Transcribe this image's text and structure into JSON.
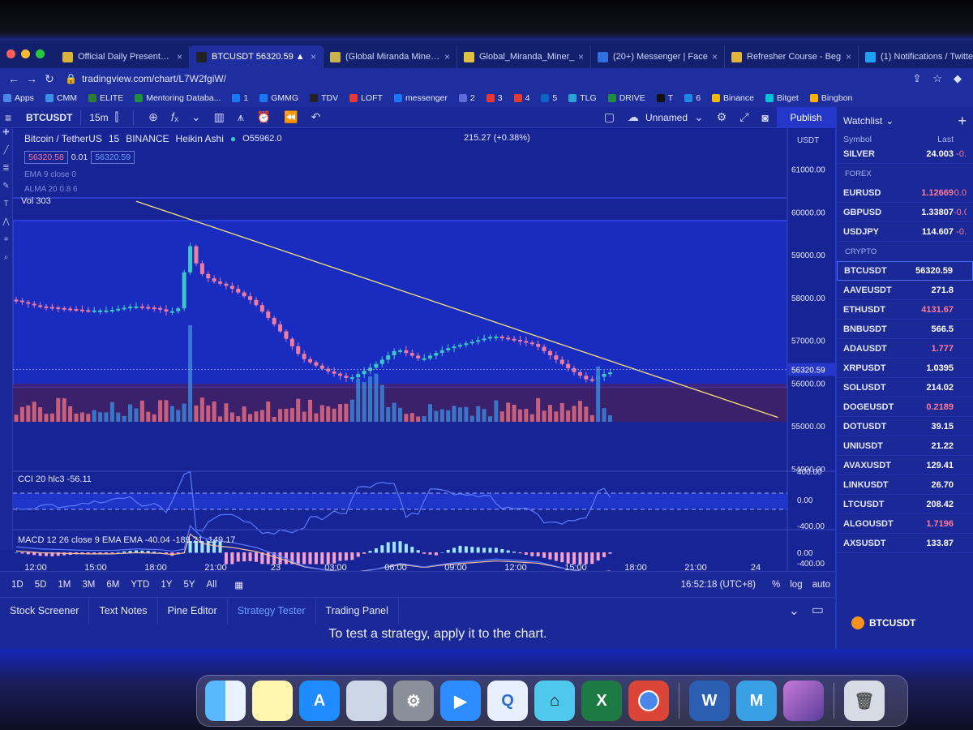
{
  "browser": {
    "tabs": [
      {
        "title": "Official Daily Presentatio",
        "favicon_color": "#d9b23a"
      },
      {
        "title": "BTCUSDT 56320.59 ▲",
        "favicon_color": "#222222",
        "active": true
      },
      {
        "title": "(Global Miranda Miner G",
        "favicon_color": "#c9b34a"
      },
      {
        "title": "Global_Miranda_Miner_",
        "favicon_color": "#e0c040"
      },
      {
        "title": "(20+) Messenger | Face",
        "favicon_color": "#2f6fe0"
      },
      {
        "title": "Refresher Course - Beg",
        "favicon_color": "#e2b43a"
      },
      {
        "title": "(1) Notifications / Twitte",
        "favicon_color": "#1da1f2"
      }
    ],
    "url": "tradingview.com/chart/L7W2fgiW/",
    "bookmarks": [
      "Apps",
      "CMM",
      "ELITE",
      "Mentoring Databa...",
      "1",
      "GMMG",
      "TDV",
      "LOFT",
      "messenger",
      "2",
      "3",
      "4",
      "5",
      "TLG",
      "DRIVE",
      "T",
      "6",
      "Binance",
      "Bitget",
      "Bingbon"
    ]
  },
  "toolbar": {
    "symbol": "BTCUSDT",
    "interval": "15m",
    "layout_name": "Unnamed",
    "publish_label": "Publish"
  },
  "legend": {
    "title": "Bitcoin / TetherUS",
    "interval": "15",
    "exchange": "BINANCE",
    "chart_style": "Heikin Ashi",
    "price_readout": "O55962.0",
    "bid": "56320.58",
    "spread": "0.01",
    "ask": "56320.59",
    "change": "215.27 (+0.38%)",
    "ema": "EMA 9 close 0",
    "alma": "ALMA 20 0.8 6",
    "volume": "Vol 303"
  },
  "chart_data": {
    "type": "candlestick",
    "symbol": "BTCUSDT",
    "currency": "USDT",
    "y_ticks": [
      "61000.00",
      "60000.00",
      "59000.00",
      "58000.00",
      "57000.00",
      "56000.00",
      "55000.00",
      "54000.00"
    ],
    "x_ticks": [
      "12:00",
      "15:00",
      "18:00",
      "21:00",
      "23",
      "03:00",
      "06:00",
      "09:00",
      "12:00",
      "15:00",
      "18:00",
      "21:00",
      "24"
    ],
    "ylim": [
      54000,
      61200
    ],
    "price_path": [
      [
        0,
        57950
      ],
      [
        4,
        57800
      ],
      [
        8,
        57750
      ],
      [
        12,
        57700
      ],
      [
        16,
        57700
      ],
      [
        20,
        57800
      ],
      [
        24,
        57750
      ],
      [
        26,
        57650
      ],
      [
        28,
        57780
      ],
      [
        29,
        59400
      ],
      [
        31,
        58600
      ],
      [
        33,
        58400
      ],
      [
        36,
        58250
      ],
      [
        40,
        57900
      ],
      [
        44,
        57300
      ],
      [
        48,
        56600
      ],
      [
        52,
        56300
      ],
      [
        56,
        56100
      ],
      [
        60,
        56400
      ],
      [
        64,
        56800
      ],
      [
        68,
        56550
      ],
      [
        72,
        56800
      ],
      [
        76,
        56950
      ],
      [
        80,
        57100
      ],
      [
        84,
        57000
      ],
      [
        87,
        56900
      ],
      [
        90,
        56600
      ],
      [
        93,
        56300
      ],
      [
        96,
        56050
      ],
      [
        99,
        56250
      ]
    ],
    "trendline": {
      "start": [
        20,
        60250
      ],
      "end": [
        127,
        55200
      ]
    },
    "current_price": 56320.59,
    "cci": {
      "label": "CCI 20 hlc3",
      "value": "-56.11",
      "y_ticks": [
        "400.00",
        "0.00",
        "-400.00"
      ]
    },
    "macd": {
      "label": "MACD 12 26 close 9 EMA EMA",
      "values": [
        "-40.04",
        "-189.21",
        "-149.17"
      ],
      "y_ticks": [
        "0.00",
        "-400.00"
      ]
    }
  },
  "timebar": {
    "ranges": [
      "1D",
      "5D",
      "1M",
      "3M",
      "6M",
      "YTD",
      "1Y",
      "5Y",
      "All"
    ],
    "clock": "16:52:18 (UTC+8)",
    "percent": "%",
    "log": "log",
    "auto": "auto"
  },
  "bottom_panel": {
    "tabs": [
      "Stock Screener",
      "Text Notes",
      "Pine Editor",
      "Strategy Tester",
      "Trading Panel"
    ],
    "active_tab": "Strategy Tester",
    "message": "To test a strategy, apply it to the chart."
  },
  "watchlist": {
    "title": "Watchlist",
    "col_symbol": "Symbol",
    "col_last": "Last",
    "items_top": [
      {
        "symbol": "SILVER",
        "last": "24.003",
        "chg": "-0."
      }
    ],
    "forex_label": "FOREX",
    "forex": [
      {
        "symbol": "EURUSD",
        "last": "1.12669",
        "chg": "0.0",
        "neg": true
      },
      {
        "symbol": "GBPUSD",
        "last": "1.33807",
        "chg": "-0.0",
        "neg": false
      },
      {
        "symbol": "USDJPY",
        "last": "114.607",
        "chg": "-0.",
        "neg": false
      }
    ],
    "crypto_label": "CRYPTO",
    "crypto": [
      {
        "symbol": "BTCUSDT",
        "last": "56320.59",
        "neg": false
      },
      {
        "symbol": "AAVEUSDT",
        "last": "271.8",
        "neg": false
      },
      {
        "symbol": "ETHUSDT",
        "last": "4131.67",
        "neg": true
      },
      {
        "symbol": "BNBUSDT",
        "last": "566.5",
        "neg": false
      },
      {
        "symbol": "ADAUSDT",
        "last": "1.777",
        "neg": true
      },
      {
        "symbol": "XRPUSDT",
        "last": "1.0395",
        "neg": false
      },
      {
        "symbol": "SOLUSDT",
        "last": "214.02",
        "neg": false
      },
      {
        "symbol": "DOGEUSDT",
        "last": "0.2189",
        "neg": true
      },
      {
        "symbol": "DOTUSDT",
        "last": "39.15",
        "neg": false
      },
      {
        "symbol": "UNIUSDT",
        "last": "21.22",
        "neg": false
      },
      {
        "symbol": "AVAXUSDT",
        "last": "129.41",
        "neg": false
      },
      {
        "symbol": "LINKUSDT",
        "last": "26.70",
        "neg": false
      },
      {
        "symbol": "LTCUSDT",
        "last": "208.42",
        "neg": false
      },
      {
        "symbol": "ALGOUSDT",
        "last": "1.7196",
        "neg": true
      },
      {
        "symbol": "AXSUSDT",
        "last": "133.87",
        "neg": false
      }
    ],
    "footer_symbol": "BTCUSDT"
  },
  "colors": {
    "up": "#3ec7c7",
    "down": "#f07aa0",
    "trendline": "#f5e27a",
    "bg": "#172495",
    "accent": "#2437c8"
  }
}
